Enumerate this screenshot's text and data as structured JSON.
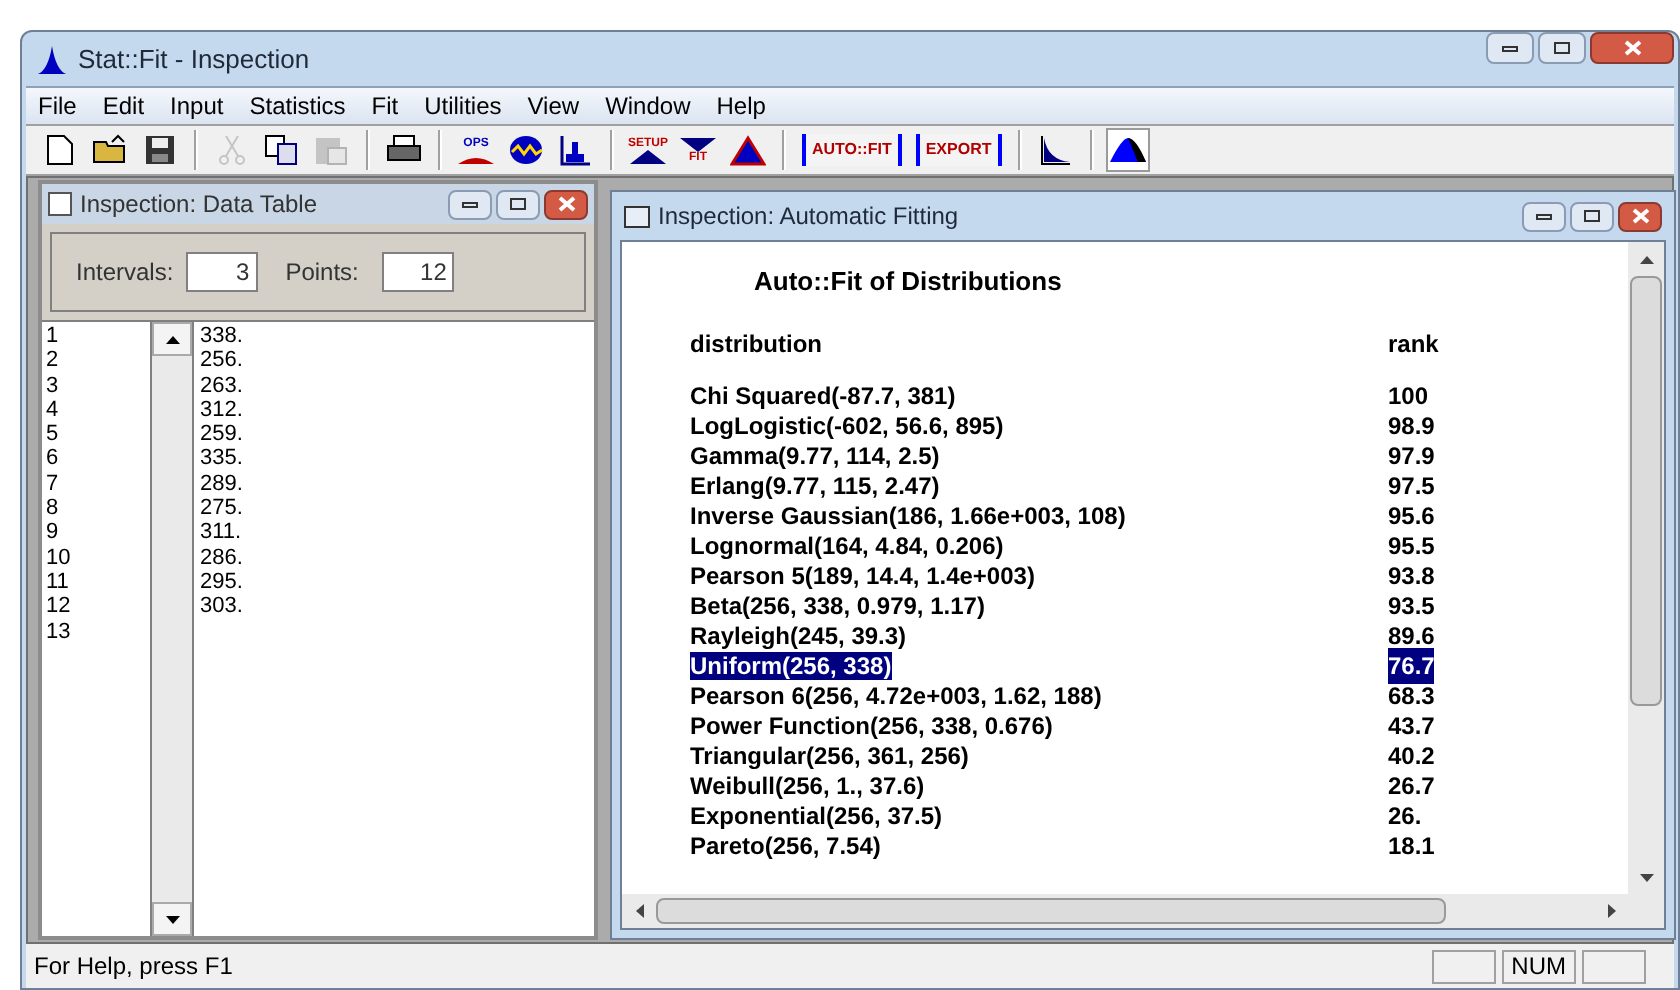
{
  "window": {
    "title": "Stat::Fit - Inspection"
  },
  "menu": [
    "File",
    "Edit",
    "Input",
    "Statistics",
    "Fit",
    "Utilities",
    "View",
    "Window",
    "Help"
  ],
  "toolbar": [
    {
      "kind": "icon",
      "disabled": false,
      "pressed": false
    },
    {
      "kind": "icon",
      "disabled": false,
      "pressed": false
    },
    {
      "kind": "icon",
      "disabled": false,
      "pressed": false
    },
    {
      "kind": "separator"
    },
    {
      "kind": "icon",
      "disabled": true,
      "pressed": false
    },
    {
      "kind": "icon",
      "disabled": false,
      "pressed": false
    },
    {
      "kind": "icon",
      "disabled": true,
      "pressed": false
    },
    {
      "kind": "separator"
    },
    {
      "kind": "icon",
      "disabled": false,
      "pressed": false
    },
    {
      "kind": "separator"
    },
    {
      "kind": "icon",
      "label": "OPS",
      "disabled": false,
      "pressed": false
    },
    {
      "kind": "icon",
      "disabled": false,
      "pressed": false
    },
    {
      "kind": "icon",
      "disabled": false,
      "pressed": false
    },
    {
      "kind": "separator"
    },
    {
      "kind": "icon",
      "label": "SETUP",
      "disabled": false,
      "pressed": false
    },
    {
      "kind": "icon",
      "label": "FIT",
      "disabled": false,
      "pressed": false
    },
    {
      "kind": "icon",
      "disabled": false,
      "pressed": false
    },
    {
      "kind": "separator"
    },
    {
      "kind": "text",
      "label": "AUTO::FIT",
      "disabled": false,
      "pressed": false
    },
    {
      "kind": "text",
      "label": "EXPORT",
      "disabled": false,
      "pressed": false
    },
    {
      "kind": "separator"
    },
    {
      "kind": "icon",
      "disabled": false,
      "pressed": false
    },
    {
      "kind": "separator"
    },
    {
      "kind": "icon",
      "disabled": false,
      "pressed": true
    }
  ],
  "data_table": {
    "title": "Inspection: Data Table",
    "intervals": {
      "label": "Intervals:",
      "value": "3"
    },
    "points": {
      "label": "Points:",
      "value": "12"
    },
    "index": [
      "1",
      "2",
      "3",
      "4",
      "5",
      "6",
      "7",
      "8",
      "9",
      "10",
      "11",
      "12",
      "13"
    ],
    "values": [
      "338.",
      "256.",
      "263.",
      "312.",
      "259.",
      "335.",
      "289.",
      "275.",
      "311.",
      "286.",
      "295.",
      "303."
    ]
  },
  "fitting": {
    "title": "Inspection: Automatic Fitting",
    "heading": "Auto::Fit of Distributions",
    "columns": [
      "distribution",
      "rank"
    ],
    "rows": [
      {
        "distribution": "Chi Squared(-87.7, 381)",
        "rank": "100",
        "selected": false
      },
      {
        "distribution": "LogLogistic(-602, 56.6, 895)",
        "rank": "98.9",
        "selected": false
      },
      {
        "distribution": "Gamma(9.77, 114, 2.5)",
        "rank": "97.9",
        "selected": false
      },
      {
        "distribution": "Erlang(9.77, 115, 2.47)",
        "rank": "97.5",
        "selected": false
      },
      {
        "distribution": "Inverse Gaussian(186, 1.66e+003, 108)",
        "rank": "95.6",
        "selected": false
      },
      {
        "distribution": "Lognormal(164, 4.84, 0.206)",
        "rank": "95.5",
        "selected": false
      },
      {
        "distribution": "Pearson 5(189, 14.4, 1.4e+003)",
        "rank": "93.8",
        "selected": false
      },
      {
        "distribution": "Beta(256, 338, 0.979, 1.17)",
        "rank": "93.5",
        "selected": false
      },
      {
        "distribution": "Rayleigh(245, 39.3)",
        "rank": "89.6",
        "selected": false
      },
      {
        "distribution": "Uniform(256, 338)",
        "rank": "76.7",
        "selected": true
      },
      {
        "distribution": "Pearson 6(256, 4.72e+003, 1.62, 188)",
        "rank": "68.3",
        "selected": false
      },
      {
        "distribution": "Power Function(256, 338, 0.676)",
        "rank": "43.7",
        "selected": false
      },
      {
        "distribution": "Triangular(256, 361, 256)",
        "rank": "40.2",
        "selected": false
      },
      {
        "distribution": "Weibull(256, 1., 37.6)",
        "rank": "26.7",
        "selected": false
      },
      {
        "distribution": "Exponential(256, 37.5)",
        "rank": "26.",
        "selected": false
      },
      {
        "distribution": "Pareto(256, 7.54)",
        "rank": "18.1",
        "selected": false
      }
    ]
  },
  "status_bar": {
    "text": "For Help, press F1",
    "indicators": [
      "NUM"
    ]
  }
}
